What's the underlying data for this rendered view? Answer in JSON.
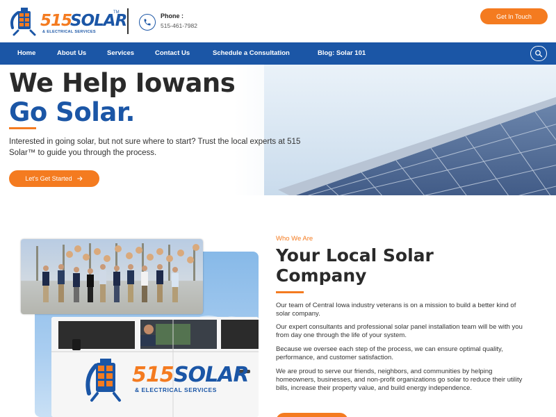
{
  "header": {
    "logo_number": "515",
    "logo_word": "SOLAR",
    "logo_tm": "TM",
    "logo_sub": "& ELECTRICAL SERVICES",
    "phone_label": "Phone :",
    "phone_number": "515-461-7982",
    "cta_label": "Get In Touch"
  },
  "nav": {
    "items": [
      {
        "label": "Home"
      },
      {
        "label": "About Us"
      },
      {
        "label": "Services"
      },
      {
        "label": "Contact Us"
      },
      {
        "label": "Schedule a Consultation"
      },
      {
        "label": "Blog: Solar 101"
      }
    ]
  },
  "hero": {
    "title_line1": "We Help Iowans",
    "title_line2": "Go Solar.",
    "text": "Interested in going solar, but not sure where to start? Trust the local experts at 515 Solar™ to guide you through the process.",
    "button_label": "Let's Get Started"
  },
  "about": {
    "eyebrow": "Who We Are",
    "title": "Your Local Solar Company",
    "paragraphs": [
      "Our team of Central Iowa industry veterans is on a mission to build a better kind of solar company.",
      "Our expert consultants and professional solar panel installation team will be with you from day one through the life of your system.",
      "Because we oversee each step of the process, we can ensure optimal quality, performance, and customer satisfaction.",
      "We are proud to serve our friends, neighbors, and communities by helping homeowners, businesses, and non-profit organizations go solar to reduce their utility bills, increase their property value, and build energy independence."
    ],
    "truck_logo_number": "515",
    "truck_logo_word": "SOLAR",
    "truck_logo_sub": "& ELECTRICAL SERVICES"
  },
  "colors": {
    "brand_blue": "#1b56a6",
    "brand_orange": "#f47b20"
  }
}
